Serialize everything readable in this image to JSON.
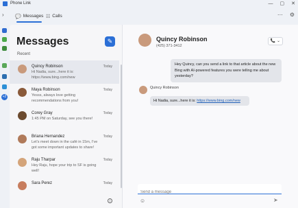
{
  "app": {
    "title": "Phone Link",
    "min": "—",
    "max": "▢",
    "close": "✕"
  },
  "nav": {
    "back": "›",
    "tabs": [
      {
        "label": "Messages",
        "icon": "💬"
      },
      {
        "label": "Calls",
        "icon": "☷"
      }
    ],
    "more": "⋯",
    "settings": "⚙"
  },
  "rail": {
    "badge": "+2",
    "colors": [
      "#2f6bd0",
      "#4aa84a",
      "#3d8b3d",
      "#5aa85a",
      "#2d6fb0",
      "#2b8fd6"
    ]
  },
  "messages": {
    "title": "Messages",
    "compose_icon": "✎",
    "recent_label": "Recent",
    "conversations": [
      {
        "name": "Quincy Robinson",
        "time": "Today",
        "preview": "Hi Nadia, sure...here it is: https://www.bing.com/new",
        "avatar_color": "#c99a7c"
      },
      {
        "name": "Maya Robinson",
        "time": "Today",
        "preview": "Yesss, always love getting recommendations from you!",
        "avatar_color": "#8a5a3a"
      },
      {
        "name": "Corey Gray",
        "time": "Today",
        "preview": "1:45 PM on Saturday, see you there!",
        "avatar_color": "#6b4a2e"
      },
      {
        "name": "Briana Hernandez",
        "time": "Today",
        "preview": "Let's meet down in the café in 15m, I've got some important updates to share!",
        "avatar_color": "#b07a5a"
      },
      {
        "name": "Raju Tharpar",
        "time": "Today",
        "preview": "Hey Raju, hope your trip to SF is going well!",
        "avatar_color": "#d4a47a"
      },
      {
        "name": "Sara Perez",
        "time": "Today",
        "preview": "",
        "avatar_color": "#c77d5e"
      }
    ],
    "info_icon": "i"
  },
  "chat": {
    "contact_name": "Quincy Robinson",
    "contact_phone": "(425) 371-3412",
    "call_button": "📞 ⌄",
    "outgoing": "Hey Quincy, can you send a link to that article about the new Bing with AI-powered features you were telling me about yesterday?",
    "incoming_name": "Quincy Robinson",
    "incoming_prefix": "Hi Nadia, sure...here it is: ",
    "incoming_link": "https://www.bing.com/new",
    "input_placeholder": "Send a message",
    "emoji_icon": "☺",
    "send_icon": "➤"
  }
}
